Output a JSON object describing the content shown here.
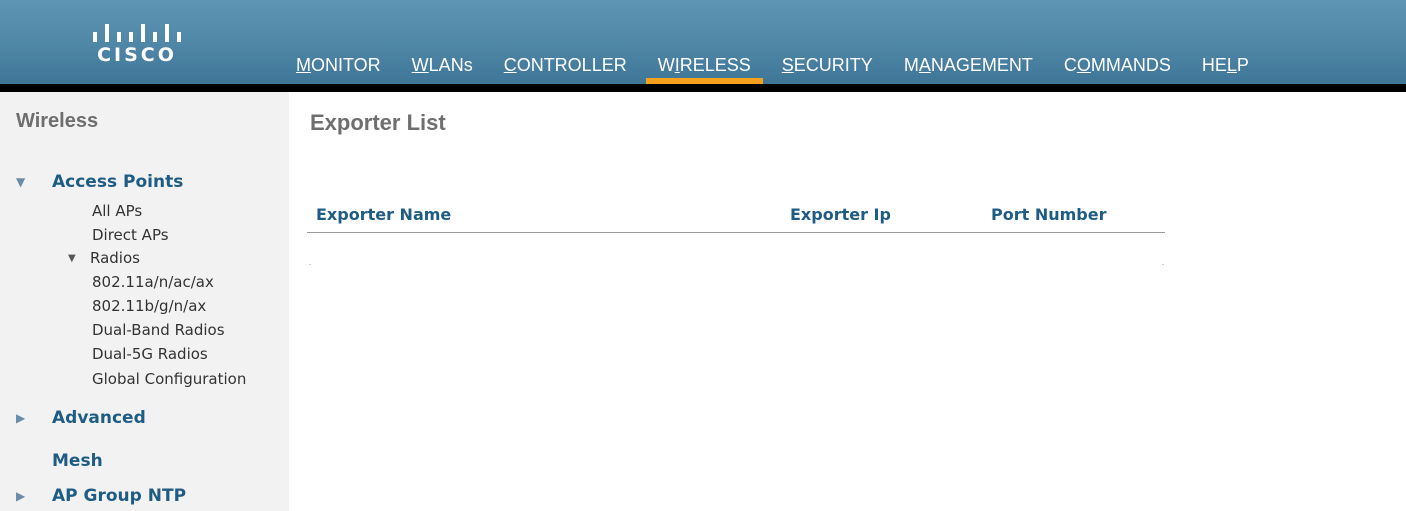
{
  "brand": {
    "logo_text": "CISCO",
    "colors": {
      "header": "#4f86a6",
      "active_tab": "#f5a11d",
      "link": "#1f5c84"
    }
  },
  "nav": {
    "items": [
      {
        "pre": "",
        "ul": "M",
        "post": "ONITOR",
        "active": false
      },
      {
        "pre": "",
        "ul": "W",
        "post": "LANs",
        "active": false
      },
      {
        "pre": "",
        "ul": "C",
        "post": "ONTROLLER",
        "active": false
      },
      {
        "pre": "W",
        "ul": "I",
        "post": "RELESS",
        "active": true
      },
      {
        "pre": "",
        "ul": "S",
        "post": "ECURITY",
        "active": false
      },
      {
        "pre": "M",
        "ul": "A",
        "post": "NAGEMENT",
        "active": false
      },
      {
        "pre": "C",
        "ul": "O",
        "post": "MMANDS",
        "active": false
      },
      {
        "pre": "HE",
        "ul": "L",
        "post": "P",
        "active": false
      }
    ]
  },
  "sidebar": {
    "title": "Wireless",
    "access_points": {
      "label": "Access Points",
      "expanded": true,
      "items": {
        "all_aps": "All APs",
        "direct_aps": "Direct APs",
        "radios": "Radios",
        "radio_a": "802.11a/n/ac/ax",
        "radio_b": "802.11b/g/n/ax",
        "dual_band": "Dual-Band Radios",
        "dual_5g": "Dual-5G Radios",
        "global_config": "Global Configuration"
      }
    },
    "advanced": {
      "label": "Advanced",
      "expanded": false
    },
    "mesh": {
      "label": "Mesh"
    },
    "ap_group_ntp": {
      "label": "AP Group NTP",
      "expanded": false
    }
  },
  "main": {
    "title": "Exporter List",
    "table": {
      "columns": [
        "Exporter Name",
        "Exporter Ip",
        "Port Number"
      ],
      "rows": []
    }
  }
}
